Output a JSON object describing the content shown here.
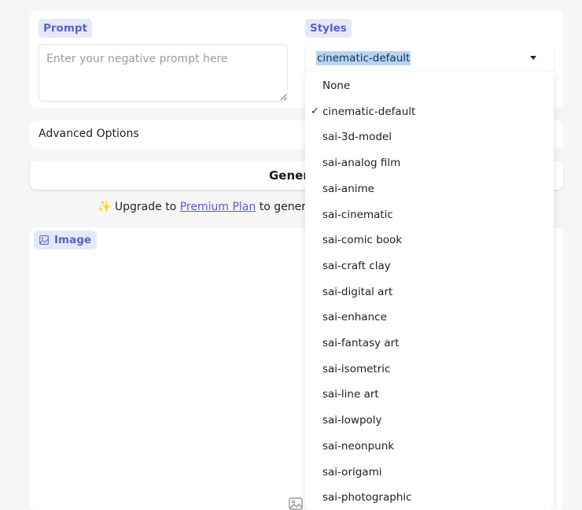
{
  "prompt": {
    "tag": "Prompt",
    "negative_placeholder": "Enter your negative prompt here"
  },
  "styles": {
    "tag": "Styles",
    "selected": "cinematic-default",
    "options": [
      "None",
      "cinematic-default",
      "sai-3d-model",
      "sai-analog film",
      "sai-anime",
      "sai-cinematic",
      "sai-comic book",
      "sai-craft clay",
      "sai-digital art",
      "sai-enhance",
      "sai-fantasy art",
      "sai-isometric",
      "sai-line art",
      "sai-lowpoly",
      "sai-neonpunk",
      "sai-origami",
      "sai-photographic"
    ]
  },
  "advanced": {
    "label": "Advanced Options"
  },
  "generate": {
    "label": "Gener"
  },
  "upgrade": {
    "sparkle": "✨",
    "prefix": "Upgrade to",
    "link": "Premium Plan",
    "suffix": "to generate"
  },
  "image": {
    "tag": "Image",
    "icon": "image-icon"
  },
  "colors": {
    "accent": "#5b62c8",
    "tag_bg": "#e6e8f9",
    "selection": "#b6d4f2",
    "link": "#5b5bd6"
  }
}
